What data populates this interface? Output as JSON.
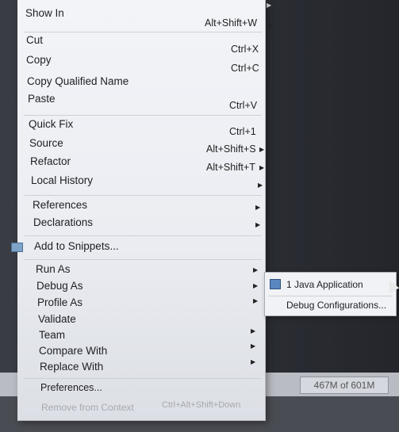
{
  "context_menu": {
    "show_in": {
      "label": "Show In",
      "shortcut": "Alt+Shift+W"
    },
    "cut": {
      "label": "Cut",
      "shortcut": "Ctrl+X"
    },
    "copy": {
      "label": "Copy",
      "shortcut": "Ctrl+C"
    },
    "copy_qualified_name": {
      "label": "Copy Qualified Name"
    },
    "paste": {
      "label": "Paste",
      "shortcut": "Ctrl+V"
    },
    "quick_fix": {
      "label": "Quick Fix",
      "shortcut": "Ctrl+1"
    },
    "source": {
      "label": "Source",
      "shortcut": "Alt+Shift+S"
    },
    "refactor": {
      "label": "Refactor",
      "shortcut": "Alt+Shift+T"
    },
    "local_history": {
      "label": "Local History"
    },
    "references": {
      "label": "References"
    },
    "declarations": {
      "label": "Declarations"
    },
    "add_to_snippets": {
      "label": "Add to Snippets..."
    },
    "run_as": {
      "label": "Run As"
    },
    "debug_as": {
      "label": "Debug As"
    },
    "profile_as": {
      "label": "Profile As"
    },
    "validate": {
      "label": "Validate"
    },
    "team": {
      "label": "Team"
    },
    "compare_with": {
      "label": "Compare With"
    },
    "replace_with": {
      "label": "Replace With"
    },
    "preferences": {
      "label": "Preferences..."
    },
    "remove_from_context": {
      "label": "Remove from Context",
      "shortcut": "Ctrl+Alt+Shift+Down"
    }
  },
  "debug_submenu": {
    "java_application": "1 Java Application",
    "debug_configurations": "Debug Configurations..."
  },
  "status_bar": {
    "heap": "467M of 601M"
  },
  "icons": {
    "submenu_arrow": "▶",
    "snippets": "snippets-icon",
    "java_app": "java-application-icon"
  }
}
